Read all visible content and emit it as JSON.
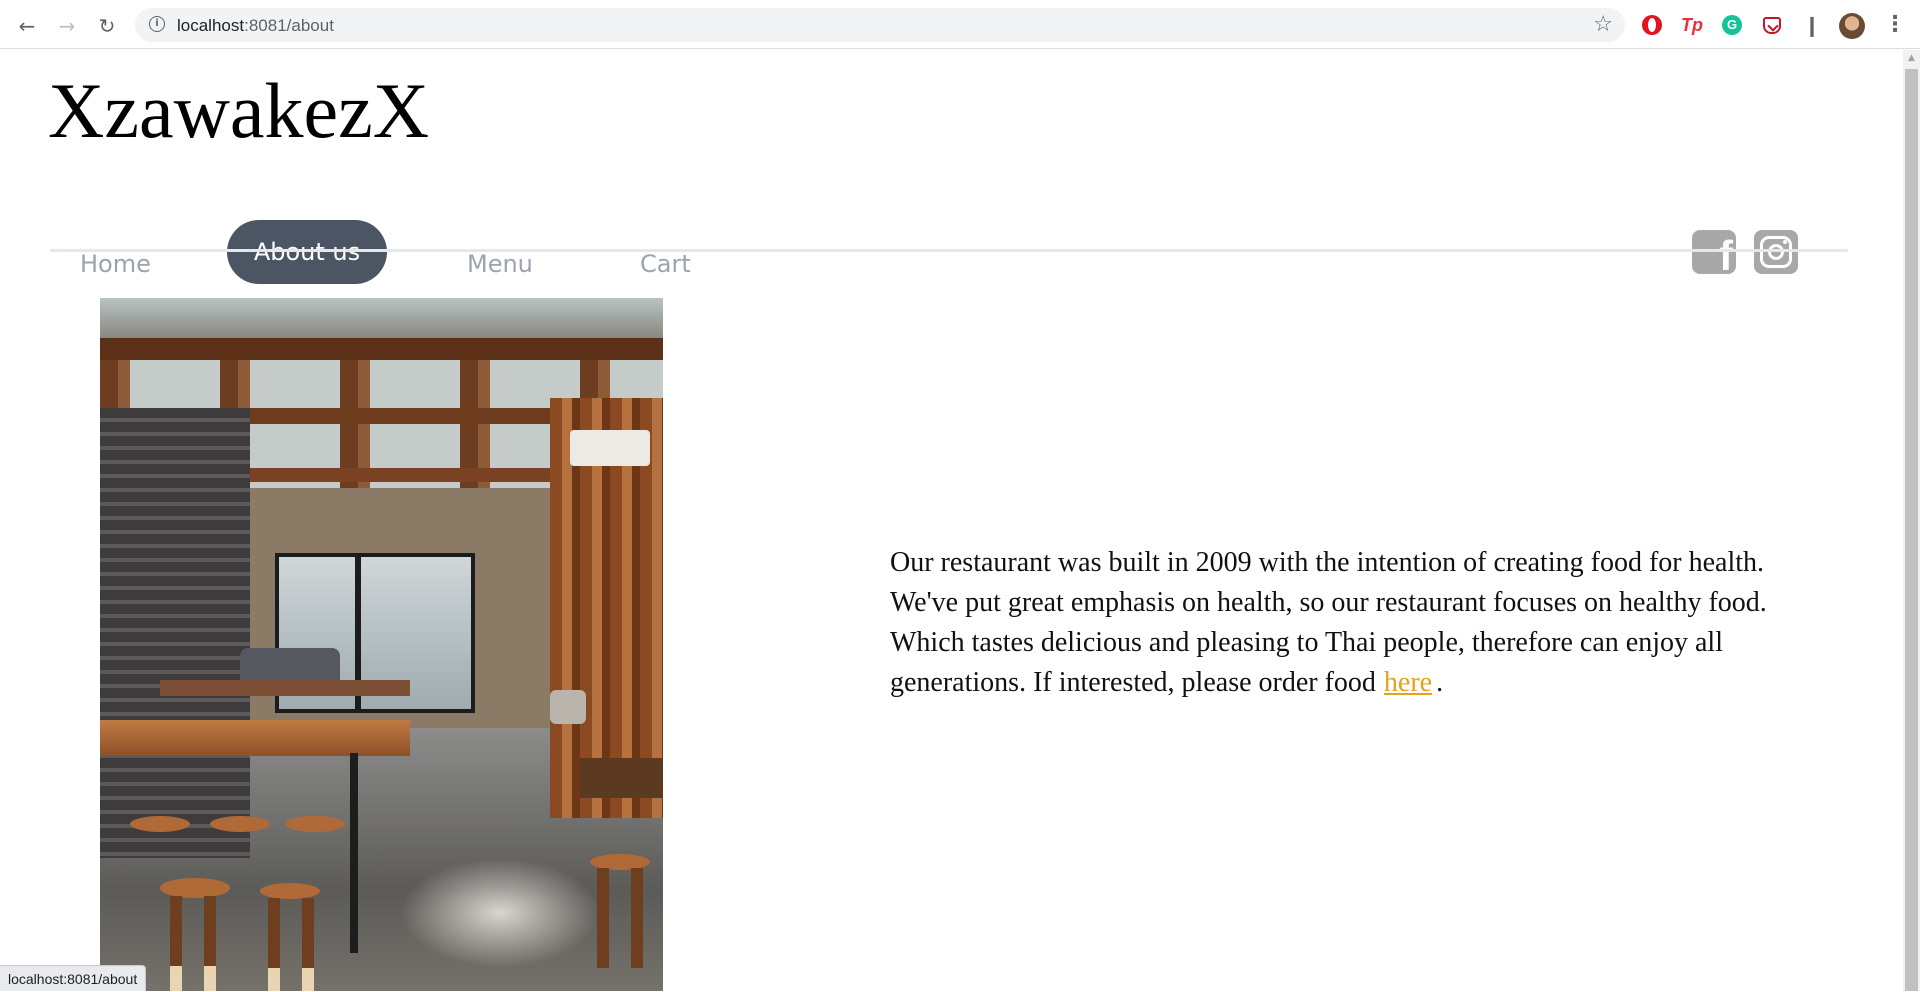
{
  "browser": {
    "url_host": "localhost",
    "url_path": ":8081/about",
    "status_url": "localhost:8081/about",
    "icons": {
      "back": "arrow-left-icon",
      "forward": "arrow-right-icon",
      "reload": "reload-icon",
      "info": "info-icon",
      "bookmark": "star-icon",
      "extensions": "puzzle-icon",
      "menu": "kebab-menu-icon"
    },
    "extensions": [
      {
        "name": "opera-extension-icon",
        "glyph": ""
      },
      {
        "name": "tp-extension-icon",
        "glyph": "Tp"
      },
      {
        "name": "grammarly-extension-icon",
        "glyph": "G"
      },
      {
        "name": "pocket-extension-icon",
        "glyph": ""
      }
    ]
  },
  "site": {
    "brand": "XzawakezX",
    "nav": [
      {
        "label": "Home",
        "active": false
      },
      {
        "label": "About us",
        "active": true
      },
      {
        "label": "Menu",
        "active": false
      },
      {
        "label": "Cart",
        "active": false
      }
    ],
    "social": [
      {
        "name": "facebook-icon",
        "glyph": "f"
      },
      {
        "name": "instagram-icon"
      }
    ],
    "colors": {
      "active_pill": "#4b5563",
      "nav_text": "#9ca3af",
      "link": "#e6a01e",
      "social_icon": "#a8a8a8"
    }
  },
  "about": {
    "image_alt": "restaurant-interior-photo",
    "lines": [
      "Our restaurant was built in 2009 with the intention of creating food for health.",
      "We've put great emphasis on health, so our restaurant focuses on healthy food.",
      "Which tastes delicious and pleasing to Thai people, therefore can enjoy all",
      "generations. If interested, please order food"
    ],
    "link_text": "here",
    "trailing": "."
  }
}
